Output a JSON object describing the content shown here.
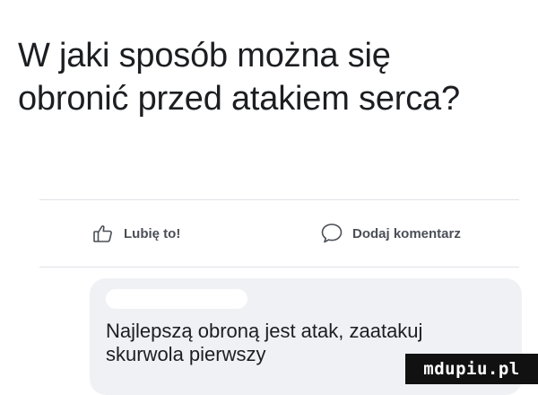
{
  "post": {
    "text_line1": "W jaki sposób można się",
    "text_line2": "obronić przed atakiem serca?"
  },
  "actions": {
    "like_label": "Lubię to!",
    "like_icon": "thumbs-up-icon",
    "comment_label": "Dodaj komentarz",
    "comment_icon": "speech-bubble-icon"
  },
  "comment": {
    "line1": "Najlepszą obroną jest atak, zaatakuj",
    "line2": "skurwola pierwszy"
  },
  "watermark": {
    "text": "mdupiu.pl"
  },
  "colors": {
    "text": "#1c1e21",
    "action_text": "#4b4f56",
    "bubble": "#eff1f4",
    "divider": "#e1e3e8"
  }
}
